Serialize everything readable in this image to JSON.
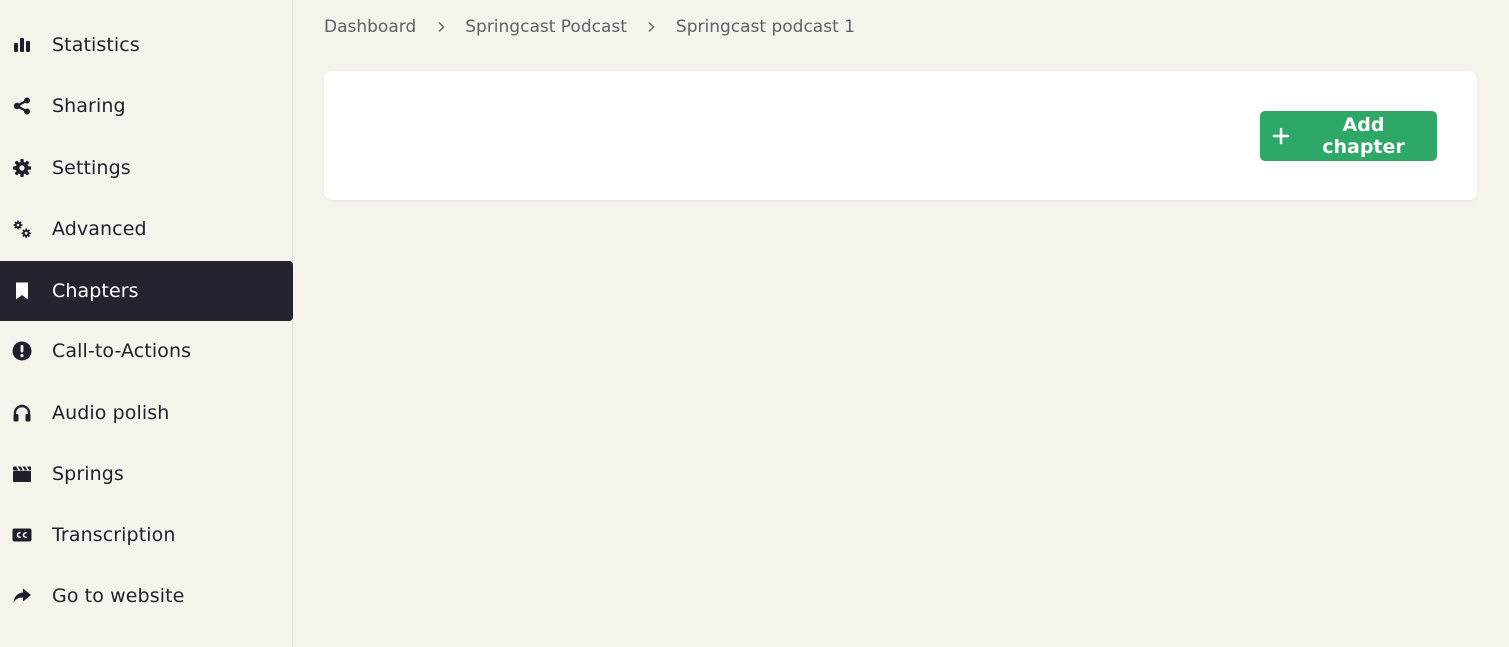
{
  "sidebar": {
    "items": [
      {
        "label": "Statistics",
        "icon": "bar-chart-icon",
        "active": false
      },
      {
        "label": "Sharing",
        "icon": "share-icon",
        "active": false
      },
      {
        "label": "Settings",
        "icon": "gear-icon",
        "active": false
      },
      {
        "label": "Advanced",
        "icon": "gears-icon",
        "active": false
      },
      {
        "label": "Chapters",
        "icon": "bookmark-icon",
        "active": true
      },
      {
        "label": "Call-to-Actions",
        "icon": "exclamation-circle-icon",
        "active": false
      },
      {
        "label": "Audio polish",
        "icon": "headphones-icon",
        "active": false
      },
      {
        "label": "Springs",
        "icon": "clapperboard-icon",
        "active": false
      },
      {
        "label": "Transcription",
        "icon": "closed-captions-icon",
        "active": false
      },
      {
        "label": "Go to website",
        "icon": "share-arrow-icon",
        "active": false
      }
    ]
  },
  "breadcrumb": {
    "items": [
      "Dashboard",
      "Springcast Podcast",
      "Springcast podcast 1"
    ]
  },
  "main": {
    "add_button_label": "Add chapter"
  },
  "colors": {
    "background": "#f6f3ec",
    "active_nav": "#24232e",
    "accent_green": "#2da866",
    "card": "#ffffff"
  }
}
